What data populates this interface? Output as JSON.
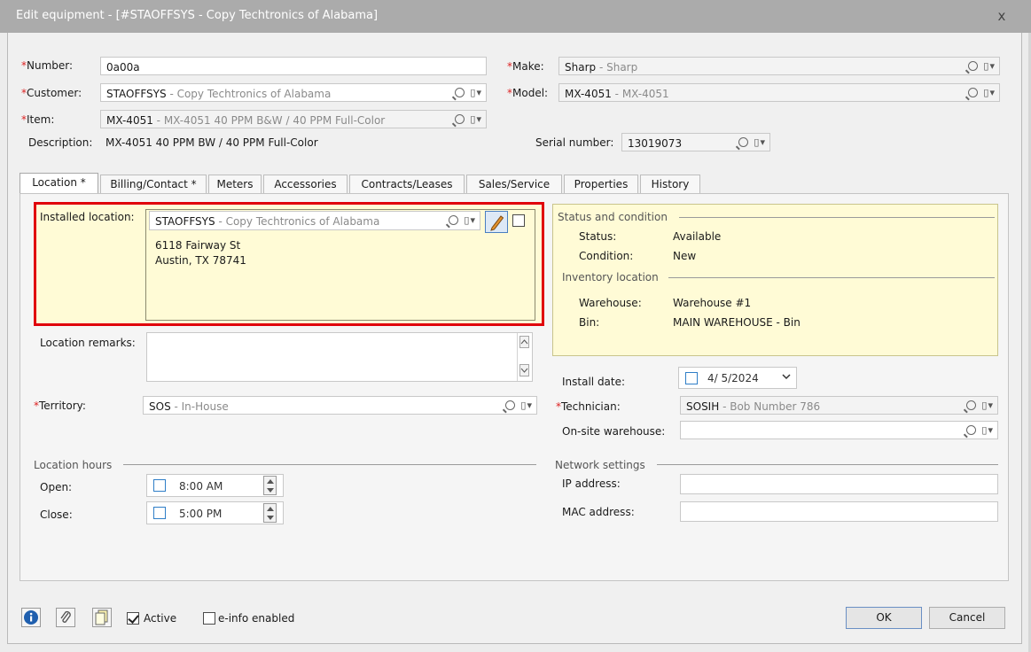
{
  "window": {
    "title": "Edit equipment - [#STAOFFSYS - Copy Techtronics of Alabama]",
    "close_glyph": "x"
  },
  "header": {
    "number": {
      "label": "Number:",
      "value": "0a00a"
    },
    "customer": {
      "label": "Customer:",
      "code": "STAOFFSYS",
      "desc": " - Copy Techtronics of Alabama"
    },
    "item": {
      "label": "Item:",
      "code": "MX-4051",
      "desc": " - MX-4051 40 PPM B&W / 40 PPM Full-Color"
    },
    "description": {
      "label": "Description:",
      "value": "MX-4051 40 PPM BW / 40 PPM Full-Color"
    },
    "make": {
      "label": "Make:",
      "code": "Sharp",
      "desc": " - Sharp"
    },
    "model": {
      "label": "Model:",
      "code": "MX-4051",
      "desc": " - MX-4051"
    },
    "serial": {
      "label": "Serial number:",
      "value": "13019073"
    }
  },
  "tabs": [
    "Location *",
    "Billing/Contact *",
    "Meters",
    "Accessories",
    "Contracts/Leases",
    "Sales/Service",
    "Properties",
    "History"
  ],
  "location": {
    "installed_label": "Installed location:",
    "installed_code": "STAOFFSYS",
    "installed_desc": " - Copy Techtronics of Alabama",
    "address_line1": "6118 Fairway St",
    "address_line2": "Austin, TX 78741",
    "remarks_label": "Location remarks:",
    "territory_label": "Territory:",
    "territory_code": "SOS",
    "territory_desc": " - In-House",
    "hours_title": "Location hours",
    "open_label": "Open:",
    "open_value": "8:00 AM",
    "close_label": "Close:",
    "close_value": "5:00 PM"
  },
  "status": {
    "group_title": "Status and condition",
    "status_label": "Status:",
    "status_value": "Available",
    "condition_label": "Condition:",
    "condition_value": "New",
    "inventory_title": "Inventory location",
    "warehouse_label": "Warehouse:",
    "warehouse_value": "Warehouse #1",
    "bin_label": "Bin:",
    "bin_value": "MAIN WAREHOUSE - Bin"
  },
  "install": {
    "date_label": "Install date:",
    "date_value": "4/ 5/2024",
    "technician_label": "Technician:",
    "technician_code": "SOSIH",
    "technician_desc": " - Bob Number 786",
    "onsite_label": "On-site warehouse:"
  },
  "network": {
    "title": "Network settings",
    "ip_label": "IP address:",
    "mac_label": "MAC address:"
  },
  "footer": {
    "active_label": "Active",
    "active_checked": true,
    "einfo_label": "e-info enabled",
    "einfo_checked": false,
    "ok_label": "OK",
    "cancel_label": "Cancel"
  },
  "colors": {
    "required": "#dd2222",
    "highlight_border": "#e0000b",
    "highlight_fill": "#fffbd6"
  }
}
